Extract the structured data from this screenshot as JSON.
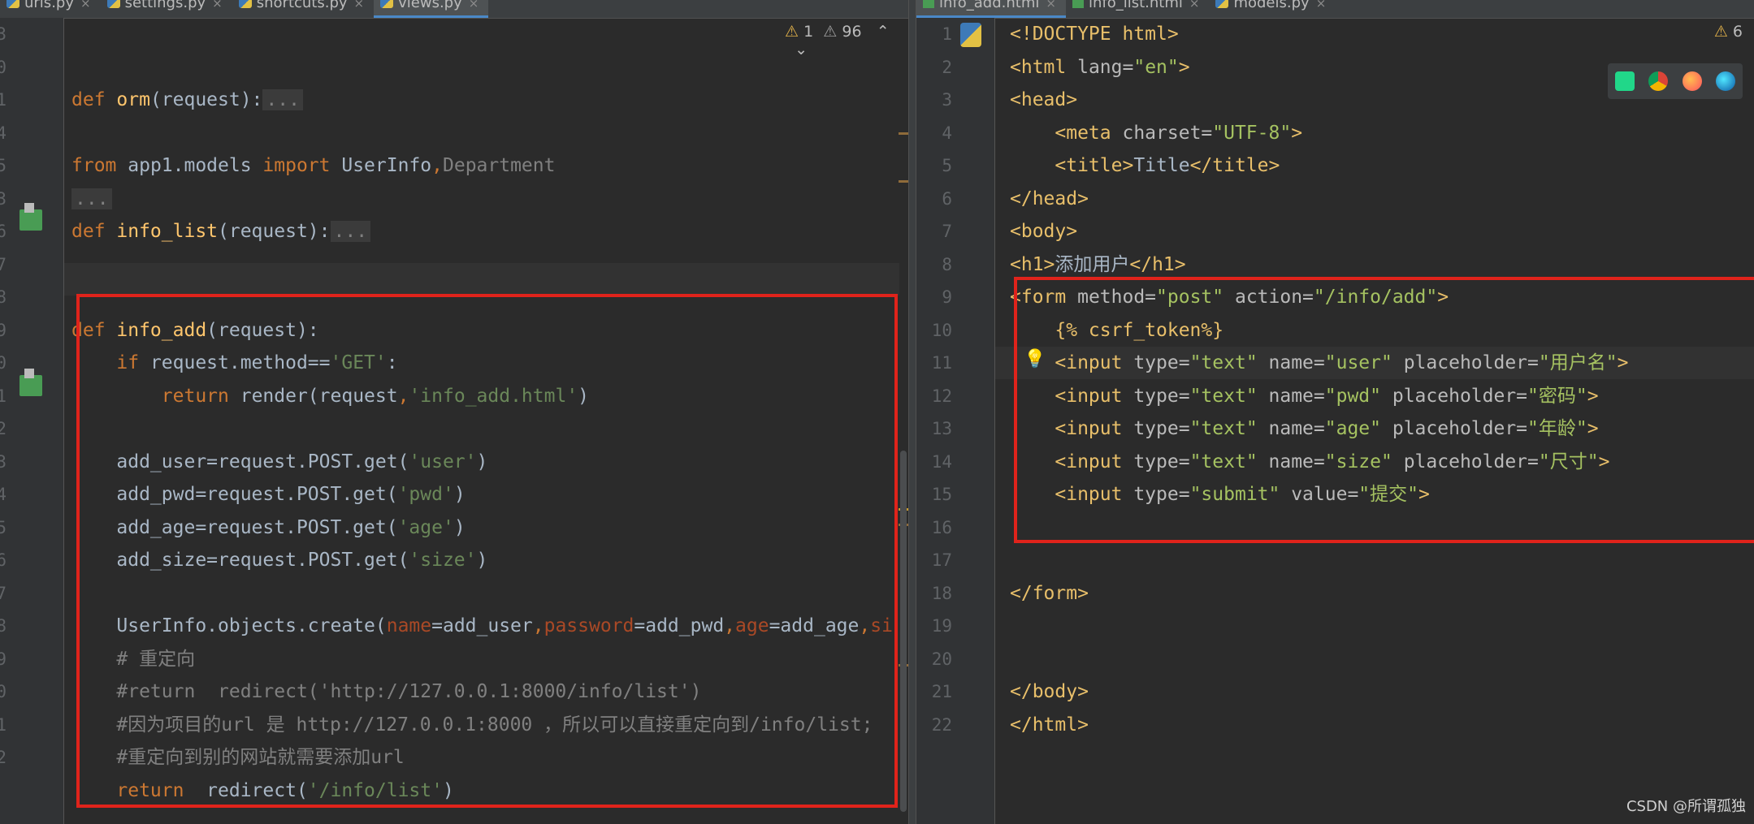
{
  "left_tabs": [
    "urls.py",
    "settings.py",
    "shortcuts.py",
    "views.py"
  ],
  "left_active_tab": 3,
  "right_tabs": [
    "info_add.html",
    "info_list.html",
    "models.py"
  ],
  "right_active_tab": 0,
  "left_warnings": {
    "warning_count": "1",
    "weak_warning_count": "96"
  },
  "right_warnings": {
    "warning_count": "6"
  },
  "left_line_numbers": [
    "3",
    "0",
    "1",
    "4",
    "5",
    "3",
    "6",
    "7",
    "8",
    "9",
    "0",
    "1",
    "2",
    "3",
    "4",
    "5",
    "6",
    "7",
    "8",
    "9",
    "0",
    "1",
    "2"
  ],
  "left_lines": [
    [],
    [],
    [
      [
        "kw",
        "def "
      ],
      [
        "fn",
        "orm"
      ],
      [
        "",
        "(request):"
      ],
      [
        "fold",
        "..."
      ]
    ],
    [],
    [
      [
        "kw",
        "from "
      ],
      [
        "",
        "app1.models "
      ],
      [
        "kw",
        "import "
      ],
      [
        "",
        "UserInfo"
      ],
      [
        "kw",
        ","
      ],
      [
        "dim",
        "Department"
      ]
    ],
    [
      [
        "fold",
        "..."
      ]
    ],
    [
      [
        "kw",
        "def "
      ],
      [
        "fn",
        "info_list"
      ],
      [
        "",
        "(request):"
      ],
      [
        "fold",
        "..."
      ]
    ],
    [],
    [],
    [
      [
        "kw",
        "def "
      ],
      [
        "fn",
        "info_add"
      ],
      [
        "",
        "(request):"
      ]
    ],
    [
      [
        "kw",
        "    if "
      ],
      [
        "",
        "request.method=="
      ],
      [
        "str",
        "'GET'"
      ],
      [
        "",
        ":"
      ]
    ],
    [
      [
        "kw",
        "        return "
      ],
      [
        "",
        "render(request"
      ],
      [
        "kw",
        ","
      ],
      [
        "str",
        "'info_add.html'"
      ],
      [
        "",
        ")"
      ]
    ],
    [],
    [
      [
        "",
        "    add_user=request.POST.get("
      ],
      [
        "str",
        "'user'"
      ],
      [
        "",
        ")"
      ]
    ],
    [
      [
        "",
        "    add_pwd=request.POST.get("
      ],
      [
        "str",
        "'pwd'"
      ],
      [
        "",
        ")"
      ]
    ],
    [
      [
        "",
        "    add_age=request.POST.get("
      ],
      [
        "str",
        "'age'"
      ],
      [
        "",
        ")"
      ]
    ],
    [
      [
        "",
        "    add_size=request.POST.get("
      ],
      [
        "str",
        "'size'"
      ],
      [
        "",
        ")"
      ]
    ],
    [],
    [
      [
        "",
        "    UserInfo.objects.create("
      ],
      [
        "param",
        "name"
      ],
      [
        "",
        "=add_user"
      ],
      [
        "kw",
        ","
      ],
      [
        "param",
        "password"
      ],
      [
        "",
        "=add_pwd"
      ],
      [
        "kw",
        ","
      ],
      [
        "param",
        "age"
      ],
      [
        "",
        "=add_age"
      ],
      [
        "kw",
        ","
      ],
      [
        "param",
        "si"
      ]
    ],
    [
      [
        "cmt",
        "    # 重定向"
      ]
    ],
    [
      [
        "cmt",
        "    #return  redirect('http://127.0.0.1:8000/info/list')"
      ]
    ],
    [
      [
        "cmt",
        "    #因为项目的url 是 http://127.0.0.1:8000 ，所以可以直接重定向到/info/list;"
      ]
    ],
    [
      [
        "cmt",
        "    #重定向到别的网站就需要添加url"
      ]
    ],
    [
      [
        "kw",
        "    return  "
      ],
      [
        "",
        "redirect("
      ],
      [
        "str",
        "'/info/list'"
      ],
      [
        "",
        ")"
      ]
    ]
  ],
  "right_line_numbers": [
    "1",
    "2",
    "3",
    "4",
    "5",
    "6",
    "7",
    "8",
    "9",
    "10",
    "11",
    "12",
    "13",
    "14",
    "15",
    "16",
    "17",
    "18",
    "19",
    "20",
    "21",
    "22"
  ],
  "right_lines": [
    [
      [
        "tag",
        "<!DOCTYPE html>"
      ]
    ],
    [
      [
        "tag",
        "<html "
      ],
      [
        "attr",
        "lang="
      ],
      [
        "aval",
        "\"en\""
      ],
      [
        "tag",
        ">"
      ]
    ],
    [
      [
        "tag",
        "<head>"
      ]
    ],
    [
      [
        "tag",
        "    <meta "
      ],
      [
        "attr",
        "charset="
      ],
      [
        "aval",
        "\"UTF-8\""
      ],
      [
        "tag",
        ">"
      ]
    ],
    [
      [
        "tag",
        "    <title>"
      ],
      [
        "",
        "Title"
      ],
      [
        "tag",
        "</title>"
      ]
    ],
    [
      [
        "tag",
        "</head>"
      ]
    ],
    [
      [
        "tag",
        "<body>"
      ]
    ],
    [
      [
        "tag",
        "<h1>"
      ],
      [
        "",
        "添加用户"
      ],
      [
        "tag",
        "</h1>"
      ]
    ],
    [
      [
        "tag",
        "<form "
      ],
      [
        "attr",
        "method="
      ],
      [
        "aval",
        "\"post\" "
      ],
      [
        "attr",
        "action="
      ],
      [
        "aval",
        "\"/info/add\""
      ],
      [
        "tag",
        ">"
      ]
    ],
    [
      [
        "tmpl",
        "    {% csrf_token%}"
      ]
    ],
    [
      [
        "tag",
        "    <input "
      ],
      [
        "attr",
        "type="
      ],
      [
        "aval",
        "\"text\" "
      ],
      [
        "attr",
        "name="
      ],
      [
        "aval",
        "\"user\" "
      ],
      [
        "attr",
        "placeholder="
      ],
      [
        "aval",
        "\"用户名\""
      ],
      [
        "tag",
        ">"
      ]
    ],
    [
      [
        "tag",
        "    <input "
      ],
      [
        "attr",
        "type="
      ],
      [
        "aval",
        "\"text\" "
      ],
      [
        "attr",
        "name="
      ],
      [
        "aval",
        "\"pwd\" "
      ],
      [
        "attr",
        "placeholder="
      ],
      [
        "aval",
        "\"密码\""
      ],
      [
        "tag",
        ">"
      ]
    ],
    [
      [
        "tag",
        "    <input "
      ],
      [
        "attr",
        "type="
      ],
      [
        "aval",
        "\"text\" "
      ],
      [
        "attr",
        "name="
      ],
      [
        "aval",
        "\"age\" "
      ],
      [
        "attr",
        "placeholder="
      ],
      [
        "aval",
        "\"年龄\""
      ],
      [
        "tag",
        ">"
      ]
    ],
    [
      [
        "tag",
        "    <input "
      ],
      [
        "attr",
        "type="
      ],
      [
        "aval",
        "\"text\" "
      ],
      [
        "attr",
        "name="
      ],
      [
        "aval",
        "\"size\" "
      ],
      [
        "attr",
        "placeholder="
      ],
      [
        "aval",
        "\"尺寸\""
      ],
      [
        "tag",
        ">"
      ]
    ],
    [
      [
        "tag",
        "    <input "
      ],
      [
        "attr",
        "type="
      ],
      [
        "aval",
        "\"submit\" "
      ],
      [
        "attr",
        "value="
      ],
      [
        "aval",
        "\"提交\""
      ],
      [
        "tag",
        ">"
      ]
    ],
    [],
    [],
    [
      [
        "tag",
        "</form>"
      ]
    ],
    [],
    [],
    [
      [
        "tag",
        "</body>"
      ]
    ],
    [
      [
        "tag",
        "</html>"
      ]
    ]
  ],
  "browsers": [
    "pycharm-icon",
    "chrome-icon",
    "firefox-icon",
    "edge-icon"
  ],
  "watermark": "CSDN @所谓孤独",
  "colors": {
    "keyword": "#cc7832",
    "function": "#ffc66d",
    "string": "#6a8759",
    "comment": "#808080",
    "tag": "#e8bf6a",
    "highlight_box": "#e0231b"
  }
}
